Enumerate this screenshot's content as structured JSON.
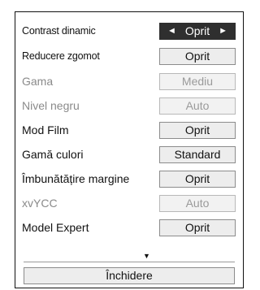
{
  "settings": [
    {
      "label": "Contrast dinamic",
      "value": "Oprit",
      "state": "selected",
      "narrow": true
    },
    {
      "label": "Reducere zgomot",
      "value": "Oprit",
      "state": "normal",
      "narrow": true
    },
    {
      "label": "Gama",
      "value": "Mediu",
      "state": "disabled",
      "narrow": false
    },
    {
      "label": "Nivel negru",
      "value": "Auto",
      "state": "disabled",
      "narrow": false
    },
    {
      "label": "Mod Film",
      "value": "Oprit",
      "state": "normal",
      "narrow": false
    },
    {
      "label": "Gamă culori",
      "value": "Standard",
      "state": "normal",
      "narrow": false
    },
    {
      "label": "Îmbunătățire margine",
      "value": "Oprit",
      "state": "normal",
      "narrow": false
    },
    {
      "label": "xvYCC",
      "value": "Auto",
      "state": "disabled",
      "narrow": false
    },
    {
      "label": "Model Expert",
      "value": "Oprit",
      "state": "normal",
      "narrow": false
    }
  ],
  "icons": {
    "left_arrow": "◄",
    "right_arrow": "►",
    "scroll_down": "▼"
  },
  "close_label": "Închidere",
  "colors": {
    "selected_bg": "#2f2f2f",
    "button_bg": "#ededed",
    "disabled_text": "#8a8a8a"
  }
}
